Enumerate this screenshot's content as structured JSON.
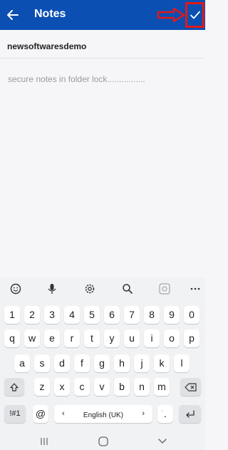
{
  "appbar": {
    "title": "Notes",
    "bg": "#0b4fb3",
    "highlight": "#e01919"
  },
  "note": {
    "title": "newsoftwaresdemo",
    "body": "secure notes in folder lock................"
  },
  "keyboard": {
    "row1": [
      "1",
      "2",
      "3",
      "4",
      "5",
      "6",
      "7",
      "8",
      "9",
      "0"
    ],
    "row2": [
      "q",
      "w",
      "e",
      "r",
      "t",
      "y",
      "u",
      "i",
      "o",
      "p"
    ],
    "row3": [
      "a",
      "s",
      "d",
      "f",
      "g",
      "h",
      "j",
      "k",
      "l"
    ],
    "row4": [
      "z",
      "x",
      "c",
      "v",
      "b",
      "n",
      "m"
    ],
    "symbols": "!#1",
    "at": "@",
    "space": "English (UK)",
    "period": ".",
    "comma": ","
  }
}
